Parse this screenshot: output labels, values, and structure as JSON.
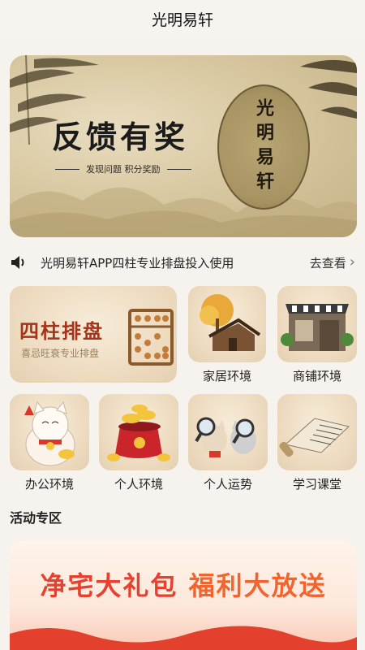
{
  "header": {
    "title": "光明易轩"
  },
  "banner": {
    "title": "反馈有奖",
    "subtitle": "发现问题 积分奖励",
    "seal": "光明易轩",
    "page_count": 2,
    "active_page": 2
  },
  "notice": {
    "text": "光明易轩APP四柱专业排盘投入使用",
    "more": "去查看"
  },
  "grid": {
    "feature": {
      "title": "四柱排盘",
      "subtitle": "喜忌旺衰专业排盘"
    },
    "items": [
      {
        "label": "家居环境",
        "icon": "house-tree-icon"
      },
      {
        "label": "商铺环境",
        "icon": "storefront-icon"
      },
      {
        "label": "办公环境",
        "icon": "lucky-cat-icon"
      },
      {
        "label": "个人环境",
        "icon": "gold-ingot-icon"
      },
      {
        "label": "个人运势",
        "icon": "magnifier-pets-icon"
      },
      {
        "label": "学习课堂",
        "icon": "scroll-book-icon"
      }
    ]
  },
  "activity": {
    "section_title": "活动专区",
    "promo_left": "净宅大礼包",
    "promo_right": "福利大放送"
  },
  "colors": {
    "feature_title": "#a4331a",
    "promo_red": "#e8402f",
    "promo_orange": "#f2642d"
  }
}
